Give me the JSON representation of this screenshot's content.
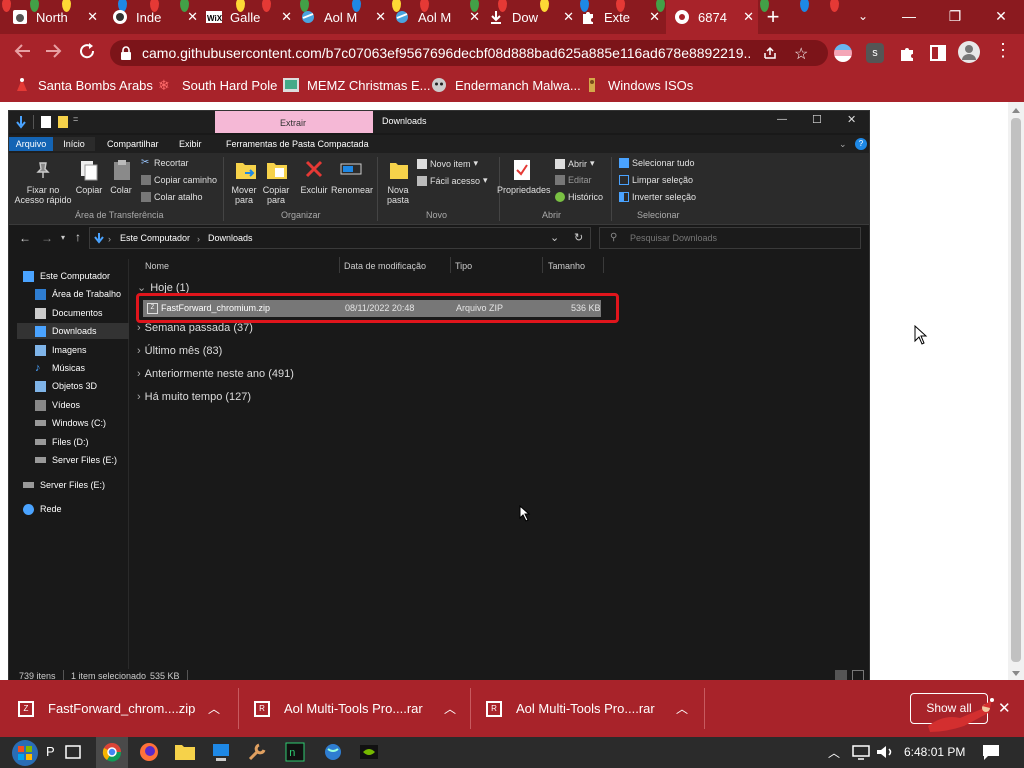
{
  "browser": {
    "tabs": [
      {
        "title": "North",
        "icon": "reddit-icon"
      },
      {
        "title": "Inde",
        "icon": "github-icon"
      },
      {
        "title": "Galle",
        "icon": "wix-icon"
      },
      {
        "title": "Aol M",
        "icon": "aol-icon"
      },
      {
        "title": "Aol M",
        "icon": "aol-icon"
      },
      {
        "title": "Dow",
        "icon": "download-icon"
      },
      {
        "title": "Exte",
        "icon": "puzzle-icon"
      },
      {
        "title": "6874",
        "icon": "globe-icon"
      }
    ],
    "url": "camo.githubusercontent.com/b7c07063ef9567696decbf08d888bad625a885e116ad678e8892219...",
    "bookmarks": [
      {
        "label": "Santa Bombs Arabs"
      },
      {
        "label": "South Hard Pole"
      },
      {
        "label": "MEMZ Christmas E..."
      },
      {
        "label": "Endermanch Malwa..."
      },
      {
        "label": "Windows ISOs"
      }
    ]
  },
  "explorer": {
    "context_tab": "Extrair",
    "title": "Downloads",
    "ribbon_tabs": [
      "Arquivo",
      "Início",
      "Compartilhar",
      "Exibir",
      "Ferramentas de Pasta Compactada"
    ],
    "clipboard": {
      "pin": "Fixar no Acesso rápido",
      "copy": "Copiar",
      "paste": "Colar",
      "cut": "Recortar",
      "copy_path": "Copiar caminho",
      "paste_shortcut": "Colar atalho",
      "group": "Área de Transferência"
    },
    "organize": {
      "move": "Mover para",
      "copy": "Copiar para",
      "delete": "Excluir",
      "rename": "Renomear",
      "group": "Organizar"
    },
    "new": {
      "folder": "Nova pasta",
      "new_item": "Novo item",
      "easy_access": "Fácil acesso",
      "group": "Novo"
    },
    "open": {
      "properties": "Propriedades",
      "open": "Abrir",
      "edit": "Editar",
      "history": "Histórico",
      "group": "Abrir"
    },
    "select": {
      "select_all": "Selecionar tudo",
      "select_none": "Limpar seleção",
      "invert": "Inverter seleção",
      "group": "Selecionar"
    },
    "breadcrumb": [
      "Este Computador",
      "Downloads"
    ],
    "search_placeholder": "Pesquisar Downloads",
    "nav": [
      {
        "label": "Este Computador"
      },
      {
        "label": "Área de Trabalho"
      },
      {
        "label": "Documentos"
      },
      {
        "label": "Downloads"
      },
      {
        "label": "Imagens"
      },
      {
        "label": "Músicas"
      },
      {
        "label": "Objetos 3D"
      },
      {
        "label": "Vídeos"
      },
      {
        "label": "Windows (C:)"
      },
      {
        "label": "Files (D:)"
      },
      {
        "label": "Server Files (E:)"
      },
      {
        "label": "Server Files (E:)"
      },
      {
        "label": "Rede"
      }
    ],
    "columns": [
      "Nome",
      "Data de modificação",
      "Tipo",
      "Tamanho"
    ],
    "groups": [
      {
        "label": "Hoje (1)"
      },
      {
        "label": "Semana passada (37)"
      },
      {
        "label": "Último mês (83)"
      },
      {
        "label": "Anteriormente neste ano (491)"
      },
      {
        "label": "Há muito tempo (127)"
      }
    ],
    "file": {
      "name": "FastForward_chromium.zip",
      "date": "08/11/2022 20:48",
      "type": "Arquivo ZIP",
      "size": "536 KB"
    },
    "status": {
      "items": "739 itens",
      "selected": "1 item selecionado",
      "size": "535 KB"
    }
  },
  "downloads_shelf": [
    {
      "name": "FastForward_chrom....zip"
    },
    {
      "name": "Aol Multi-Tools Pro....rar"
    },
    {
      "name": "Aol Multi-Tools Pro....rar"
    }
  ],
  "show_all": "Show all",
  "taskbar": {
    "time": "6:48:01 PM"
  },
  "colors": {
    "browser_red": "#a8232a",
    "tab_strip": "#8b1a1f",
    "highlight_red": "#e0151c"
  }
}
